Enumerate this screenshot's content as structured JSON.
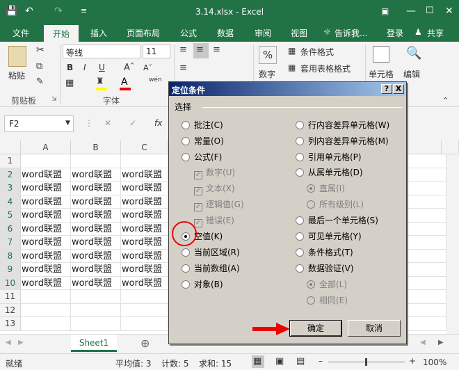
{
  "window": {
    "title": "3.14.xlsx - Excel"
  },
  "tabs": [
    "文件",
    "开始",
    "插入",
    "页面布局",
    "公式",
    "数据",
    "审阅",
    "视图"
  ],
  "tell_me": "告诉我...",
  "login": "登录",
  "share": "共享",
  "ribbon": {
    "paste": "粘贴",
    "clipboard": "剪贴板",
    "font_name": "等线",
    "font_size": "11",
    "font_group": "字体",
    "bold": "B",
    "italic": "I",
    "underline": "U",
    "wen": "wén",
    "percent": "%",
    "number": "数字",
    "cond_format": "条件格式",
    "table_format": "套用表格格式",
    "cell": "单元格",
    "edit": "编辑"
  },
  "formula": {
    "namebox": "F2",
    "fx": "fx"
  },
  "grid": {
    "columns": [
      "A",
      "B",
      "C"
    ],
    "rows": [
      "1",
      "2",
      "3",
      "4",
      "5",
      "6",
      "7",
      "8",
      "9",
      "10",
      "11",
      "12",
      "13"
    ],
    "cell_text": "word联盟"
  },
  "sheet": {
    "tab": "Sheet1"
  },
  "status": {
    "mode": "就绪",
    "avg": "平均值: 3",
    "count": "计数: 5",
    "sum": "求和: 15",
    "zoom": "100%"
  },
  "dialog": {
    "title": "定位条件",
    "help": "?",
    "close": "X",
    "group": "选择",
    "left": [
      {
        "label": "批注(C)",
        "type": "radio",
        "checked": false,
        "disabled": false
      },
      {
        "label": "常量(O)",
        "type": "radio",
        "checked": false,
        "disabled": false
      },
      {
        "label": "公式(F)",
        "type": "radio",
        "checked": false,
        "disabled": false
      },
      {
        "label": "数字(U)",
        "type": "check",
        "checked": true,
        "disabled": true
      },
      {
        "label": "文本(X)",
        "type": "check",
        "checked": true,
        "disabled": true
      },
      {
        "label": "逻辑值(G)",
        "type": "check",
        "checked": true,
        "disabled": true
      },
      {
        "label": "错误(E)",
        "type": "check",
        "checked": true,
        "disabled": true
      },
      {
        "label": "空值(K)",
        "type": "radio",
        "checked": true,
        "disabled": false
      },
      {
        "label": "当前区域(R)",
        "type": "radio",
        "checked": false,
        "disabled": false
      },
      {
        "label": "当前数组(A)",
        "type": "radio",
        "checked": false,
        "disabled": false
      },
      {
        "label": "对象(B)",
        "type": "radio",
        "checked": false,
        "disabled": false
      }
    ],
    "right": [
      {
        "label": "行内容差异单元格(W)",
        "type": "radio",
        "checked": false,
        "disabled": false
      },
      {
        "label": "列内容差异单元格(M)",
        "type": "radio",
        "checked": false,
        "disabled": false
      },
      {
        "label": "引用单元格(P)",
        "type": "radio",
        "checked": false,
        "disabled": false
      },
      {
        "label": "从属单元格(D)",
        "type": "radio",
        "checked": false,
        "disabled": false
      },
      {
        "label": "直属(I)",
        "type": "radio",
        "checked": true,
        "disabled": true
      },
      {
        "label": "所有级别(L)",
        "type": "radio",
        "checked": false,
        "disabled": true
      },
      {
        "label": "最后一个单元格(S)",
        "type": "radio",
        "checked": false,
        "disabled": false
      },
      {
        "label": "可见单元格(Y)",
        "type": "radio",
        "checked": false,
        "disabled": false
      },
      {
        "label": "条件格式(T)",
        "type": "radio",
        "checked": false,
        "disabled": false
      },
      {
        "label": "数据验证(V)",
        "type": "radio",
        "checked": false,
        "disabled": false
      },
      {
        "label": "全部(L)",
        "type": "radio",
        "checked": true,
        "disabled": true
      },
      {
        "label": "相同(E)",
        "type": "radio",
        "checked": false,
        "disabled": true
      }
    ],
    "ok": "确定",
    "cancel": "取消"
  }
}
